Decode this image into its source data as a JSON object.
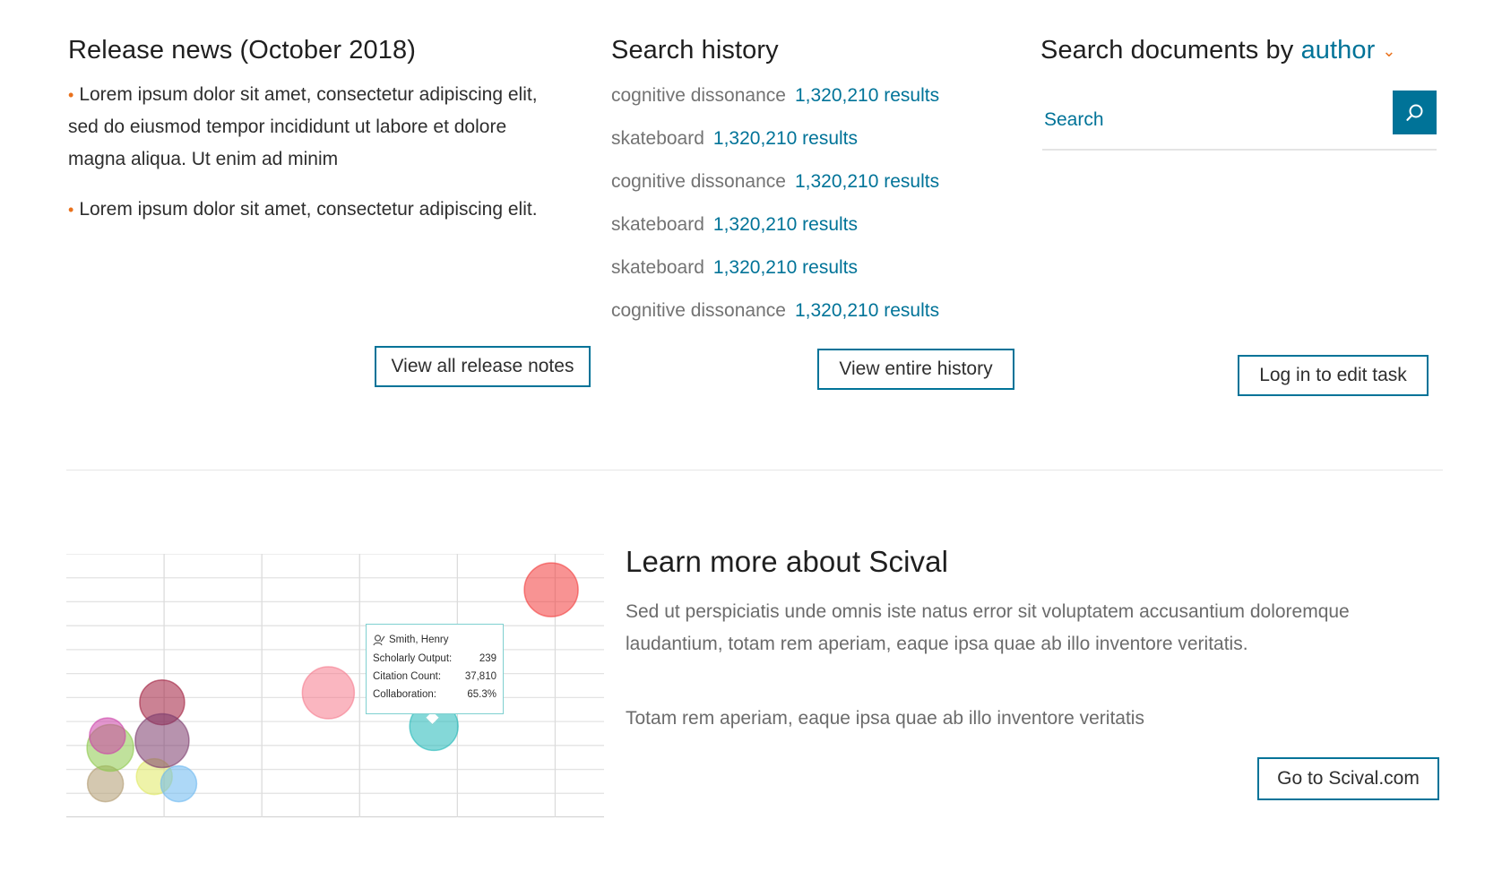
{
  "release": {
    "title": "Release news (October 2018)",
    "items": [
      "Lorem ipsum dolor sit amet, consectetur adipiscing elit, sed do eiusmod tempor incididunt ut labore et dolore magna aliqua. Ut enim ad minim",
      "Lorem ipsum dolor sit amet, consectetur adipiscing elit."
    ],
    "button": "View all release notes"
  },
  "history": {
    "title": "Search history",
    "rows": [
      {
        "term": "cognitive dissonance",
        "count": "1,320,210 results"
      },
      {
        "term": "skateboard",
        "count": "1,320,210 results"
      },
      {
        "term": "cognitive dissonance",
        "count": "1,320,210 results"
      },
      {
        "term": "skateboard",
        "count": "1,320,210 results"
      },
      {
        "term": "skateboard",
        "count": "1,320,210 results"
      },
      {
        "term": "cognitive dissonance",
        "count": "1,320,210 results"
      }
    ],
    "button": "View entire history"
  },
  "search_docs": {
    "title_prefix": "Search documents by",
    "selected_field": "author",
    "placeholder": "Search",
    "button": "Log in to edit task"
  },
  "scival": {
    "title": "Learn more about Scival",
    "paragraph1": "Sed ut perspiciatis unde omnis iste natus error sit voluptatem accusantium doloremque laudantium, totam rem aperiam, eaque ipsa quae ab illo inventore veritatis.",
    "paragraph2": "Totam rem aperiam, eaque ipsa quae ab illo inventore veritatis",
    "button": "Go to Scival.com"
  },
  "tooltip": {
    "name": "Smith, Henry",
    "rows": [
      {
        "label": "Scholarly Output:",
        "value": "239"
      },
      {
        "label": "Citation Count:",
        "value": "37,810"
      },
      {
        "label": "Collaboration:",
        "value": "65.3%"
      }
    ]
  },
  "colors": {
    "accent": "#007398",
    "bullet": "#e9711c",
    "border": "#007398"
  },
  "chart_data": {
    "type": "scatter",
    "title": "",
    "xlabel": "",
    "ylabel": "",
    "grid": true,
    "xlim": [
      0,
      5.5
    ],
    "ylim": [
      0,
      11
    ],
    "points": [
      {
        "x": 0.4,
        "y": 1.4,
        "r": 20,
        "color": "#b09a70"
      },
      {
        "x": 0.45,
        "y": 2.9,
        "r": 26,
        "color": "#8cc84b"
      },
      {
        "x": 0.9,
        "y": 1.7,
        "r": 20,
        "color": "#e0ea63"
      },
      {
        "x": 1.15,
        "y": 1.4,
        "r": 20,
        "color": "#6ab8f0"
      },
      {
        "x": 0.42,
        "y": 3.4,
        "r": 20,
        "color": "#cc3fa8"
      },
      {
        "x": 0.98,
        "y": 4.8,
        "r": 25,
        "color": "#a01c3c"
      },
      {
        "x": 0.98,
        "y": 3.2,
        "r": 30,
        "color": "#7b3a6c"
      },
      {
        "x": 2.68,
        "y": 5.2,
        "r": 29,
        "color": "#f57a8c"
      },
      {
        "x": 3.76,
        "y": 3.8,
        "r": 27,
        "color": "#1fb8b8"
      },
      {
        "x": 4.96,
        "y": 9.5,
        "r": 30,
        "color": "#f23a3a"
      }
    ]
  }
}
